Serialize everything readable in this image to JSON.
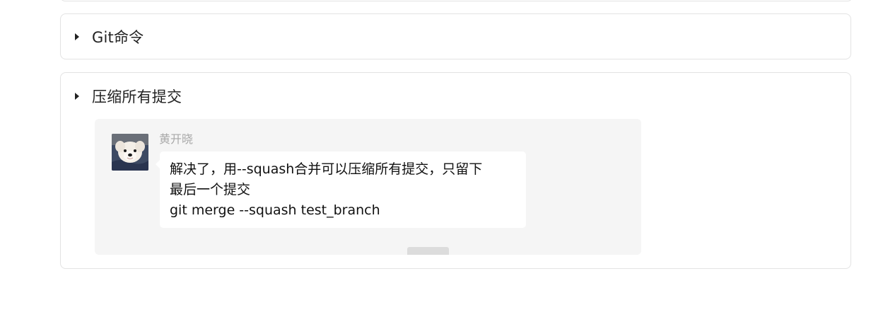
{
  "sections": [
    {
      "title": "Git命令"
    },
    {
      "title": "压缩所有提交"
    }
  ],
  "message": {
    "sender": "黄开晓",
    "lines": [
      "解决了，用--squash合并可以压缩所有提交，只留下",
      "最后一个提交",
      "git merge --squash test_branch"
    ]
  },
  "icons": {
    "expand": "caret-right-icon",
    "avatar": "dog-avatar-icon"
  },
  "colors": {
    "card_bg": "#f5f5f5",
    "bubble_bg": "#ffffff",
    "sender_text": "#a9a9a9",
    "border": "#e3e3e3"
  }
}
